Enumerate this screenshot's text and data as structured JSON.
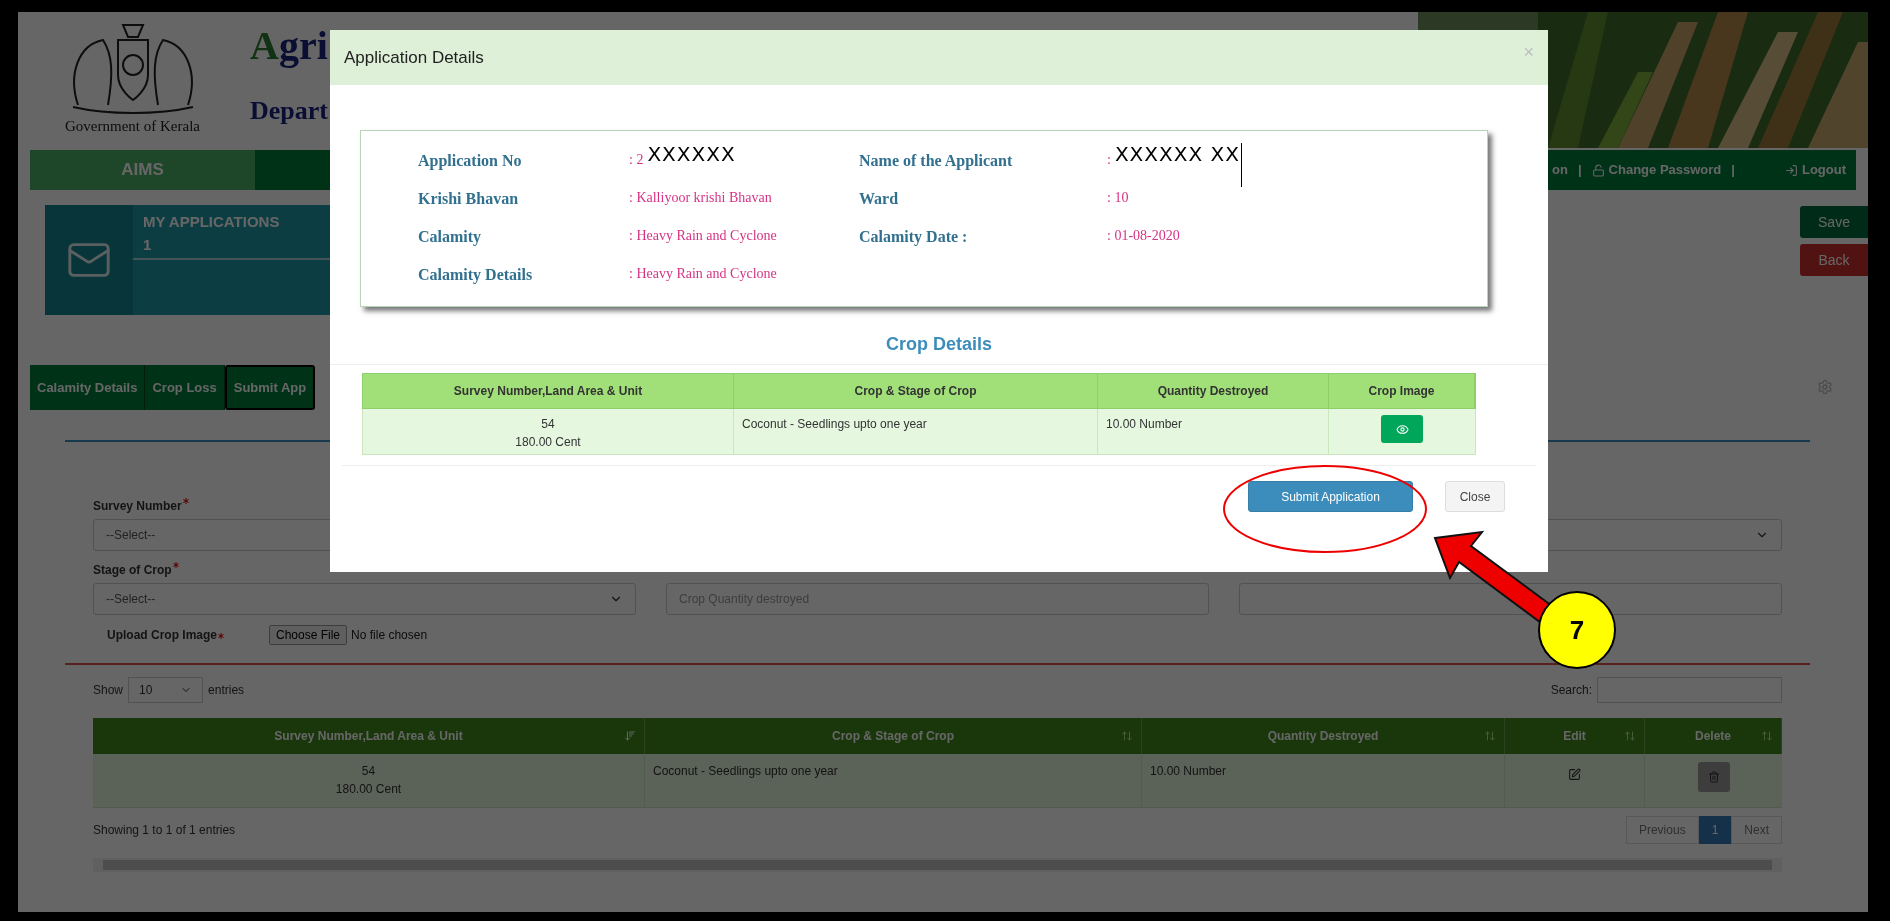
{
  "header": {
    "emblem_caption": "Government of Kerala",
    "title": "Agri",
    "subtitle": "Depart"
  },
  "nav": {
    "brand": "AIMS",
    "separators": [
      "|",
      "|"
    ],
    "links": [
      {
        "label": "on"
      },
      {
        "label": "Change Password"
      },
      {
        "label": "Logout"
      }
    ]
  },
  "side_buttons": [
    {
      "label": "Save",
      "kind": "save"
    },
    {
      "label": "Back",
      "kind": "back"
    }
  ],
  "summary_card": {
    "title": "MY APPLICATIONS",
    "count": "1"
  },
  "tabs": [
    {
      "label": "Calamity Details",
      "selected": false
    },
    {
      "label": "Crop Loss",
      "selected": false
    },
    {
      "label": "Submit App",
      "selected": true
    }
  ],
  "form": {
    "rows": [
      [
        {
          "kind": "select",
          "label": "Survey Number",
          "required": true,
          "value": "--Select--"
        }
      ],
      [
        {
          "kind": "select",
          "label": "Stage of Crop",
          "required": true,
          "value": "--Select--"
        },
        {
          "kind": "input",
          "placeholder": "Crop Quantity destroyed"
        },
        {
          "kind": "input"
        }
      ]
    ],
    "upload": {
      "label": "Upload Crop Image",
      "required": true,
      "button": "Choose File",
      "status": "No file chosen"
    }
  },
  "table_controls": {
    "show": "Show",
    "page_size": "10",
    "entries": "entries",
    "search_label": "Search:"
  },
  "table": {
    "columns": [
      {
        "label": "Survey Number,Land Area & Unit",
        "sorted": true
      },
      {
        "label": "Crop & Stage of Crop",
        "sorted": false
      },
      {
        "label": "Quantity Destroyed",
        "sorted": false
      },
      {
        "label": "Edit",
        "sorted": false
      },
      {
        "label": "Delete",
        "sorted": false
      }
    ],
    "rows": [
      {
        "survey": [
          "54",
          "180.00 Cent"
        ],
        "crop": "Coconut - Seedlings upto one year",
        "quantity": "10.00 Number"
      }
    ]
  },
  "table_info": "Showing 1 to 1 of 1 entries",
  "pagination": [
    {
      "label": "Previous",
      "selected": false
    },
    {
      "label": "1",
      "selected": true
    },
    {
      "label": "Next",
      "selected": false
    }
  ],
  "modal": {
    "title": "Application Details",
    "close": "×",
    "details": [
      [
        {
          "label": "Application No",
          "value": ": 2",
          "redacted": "XXXXXX",
          "text_cursor": false
        },
        {
          "label": "Name of the Applicant",
          "value": ":",
          "redacted": "XXXXXX XX",
          "text_cursor": true
        }
      ],
      [
        {
          "label": "Krishi Bhavan",
          "value": ": Kalliyoor krishi Bhavan"
        },
        {
          "label": "Ward",
          "value": ": 10"
        }
      ],
      [
        {
          "label": "Calamity",
          "value": ": Heavy Rain and Cyclone"
        },
        {
          "label": "Calamity Date :",
          "value": ": 01-08-2020"
        }
      ],
      [
        {
          "label": "Calamity Details",
          "value": ": Heavy Rain and Cyclone"
        }
      ]
    ],
    "crop_title": "Crop Details",
    "columns": [
      "Survey Number,Land Area & Unit",
      "Crop & Stage of Crop",
      "Quantity Destroyed",
      "Crop Image"
    ],
    "rows": [
      {
        "survey": [
          "54",
          "180.00 Cent"
        ],
        "crop": "Coconut - Seedlings upto one year",
        "quantity": "10.00 Number"
      }
    ],
    "buttons": [
      {
        "label": "Submit Application",
        "kind": "primary"
      },
      {
        "label": "Close",
        "kind": "default"
      }
    ]
  },
  "annotation": {
    "step": "7"
  }
}
